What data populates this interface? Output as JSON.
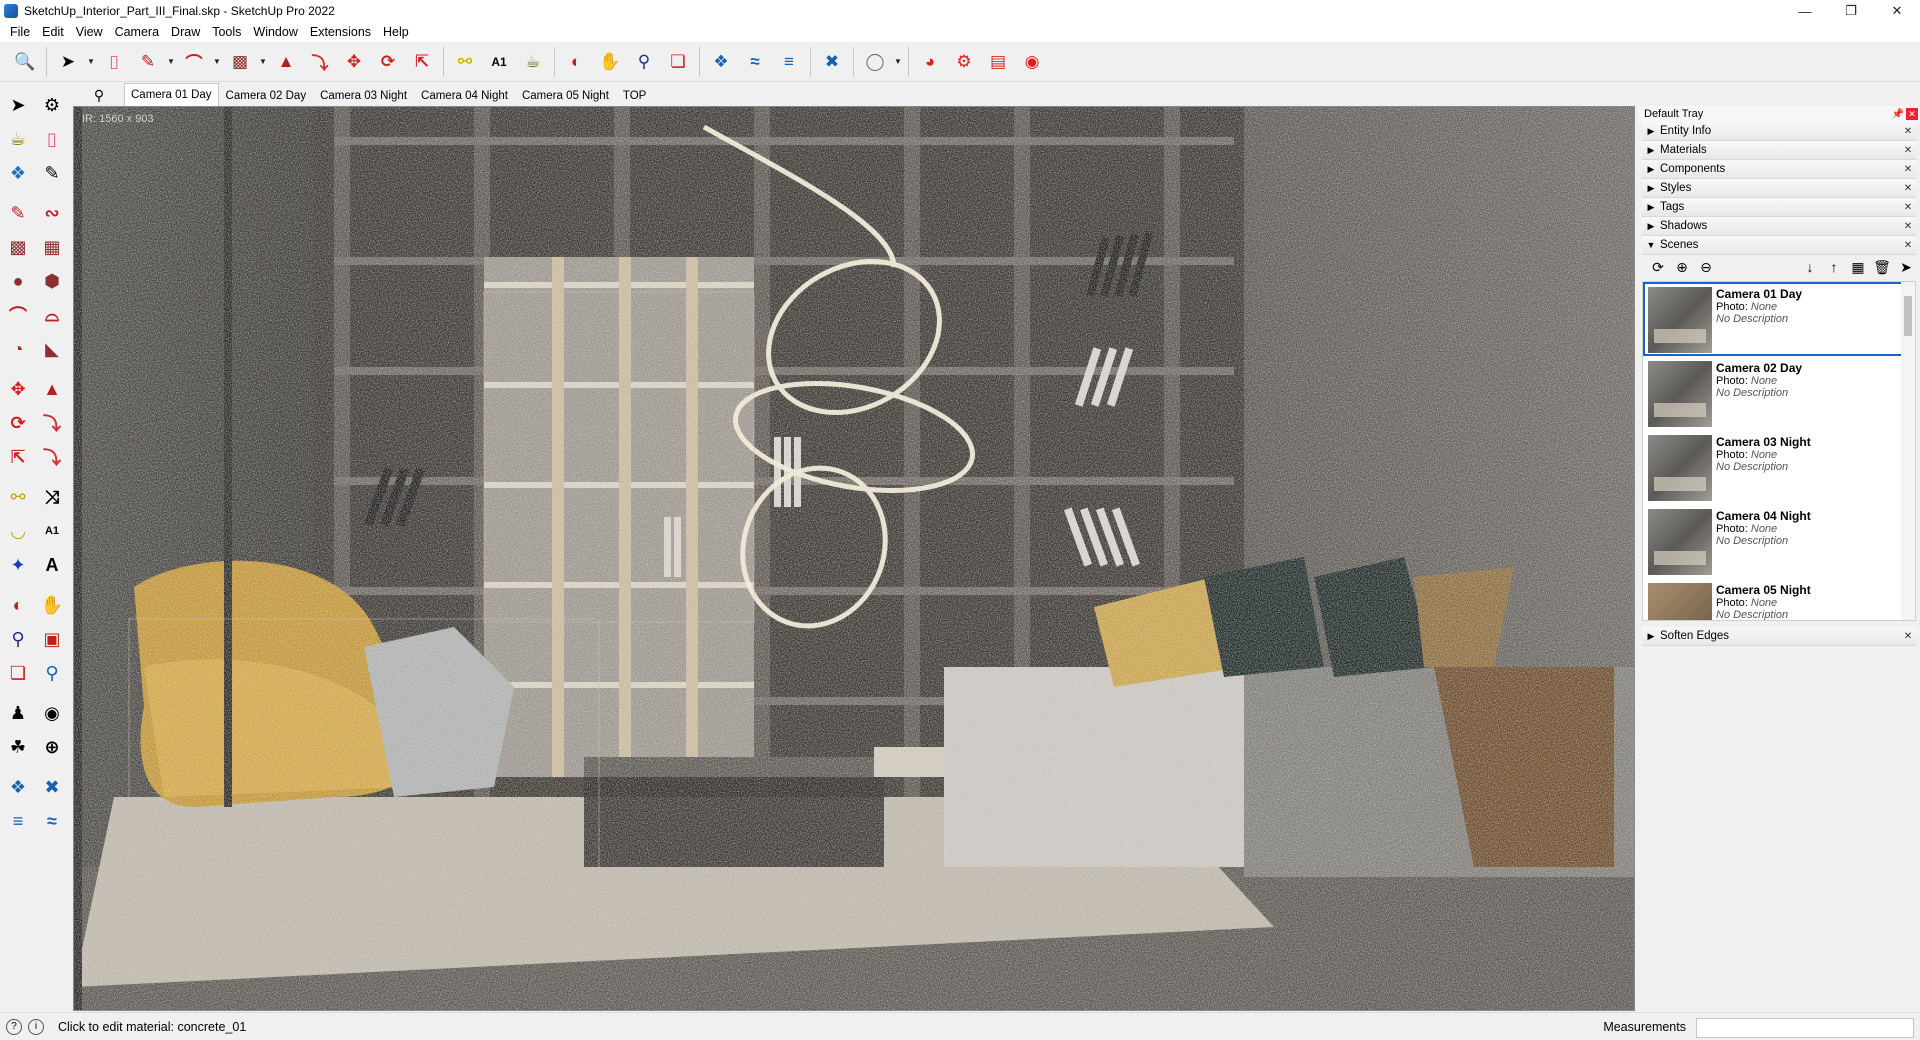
{
  "window": {
    "title": "SketchUp_Interior_Part_III_Final.skp - SketchUp Pro 2022",
    "controls": [
      "minimize",
      "maximize",
      "close"
    ]
  },
  "menubar": [
    "File",
    "Edit",
    "View",
    "Camera",
    "Draw",
    "Tools",
    "Window",
    "Extensions",
    "Help"
  ],
  "toolbar": {
    "icons": [
      "zoom-icon",
      "select-icon",
      "eraser-icon",
      "pencil-icon",
      "arc-icon",
      "rectangle-icon",
      "push-pull-icon",
      "follow-me-icon",
      "move-icon",
      "rotate-icon",
      "scale-icon",
      "tape-measure-icon",
      "text-icon",
      "paint-bucket-icon",
      "orbit-icon",
      "pan-icon",
      "zoom-tool-icon",
      "zoom-extents-icon",
      "sandbox-icon",
      "stamp-icon",
      "drape-icon",
      "section-plane-icon",
      "warehouse-icon",
      "render-icon",
      "settings-icon",
      "open-icon",
      "camera-icon"
    ]
  },
  "scene_tabs": [
    "Camera 01 Day",
    "Camera 02 Day",
    "Camera 03 Night",
    "Camera 04 Night",
    "Camera 05 Night",
    "TOP"
  ],
  "viewport": {
    "ir_label": "IR: 1560 x 903"
  },
  "tray": {
    "title": "Default Tray",
    "panels": [
      "Entity Info",
      "Materials",
      "Components",
      "Styles",
      "Tags",
      "Shadows"
    ],
    "scenes_panel": "Scenes",
    "soften_panel": "Soften Edges",
    "scenes": [
      {
        "name": "Camera 01 Day",
        "photo_label": "Photo:",
        "photo_value": "None",
        "desc": "No Description"
      },
      {
        "name": "Camera 02 Day",
        "photo_label": "Photo:",
        "photo_value": "None",
        "desc": "No Description"
      },
      {
        "name": "Camera 03 Night",
        "photo_label": "Photo:",
        "photo_value": "None",
        "desc": "No Description"
      },
      {
        "name": "Camera 04 Night",
        "photo_label": "Photo:",
        "photo_value": "None",
        "desc": "No Description"
      },
      {
        "name": "Camera 05 Night",
        "photo_label": "Photo:",
        "photo_value": "None",
        "desc": "No Description"
      }
    ]
  },
  "statusbar": {
    "message": "Click to edit material: concrete_01",
    "measurements_label": "Measurements",
    "measurements_value": ""
  },
  "colors": {
    "selected_scene_border": "#1a63c8",
    "close_button": "#e23"
  }
}
